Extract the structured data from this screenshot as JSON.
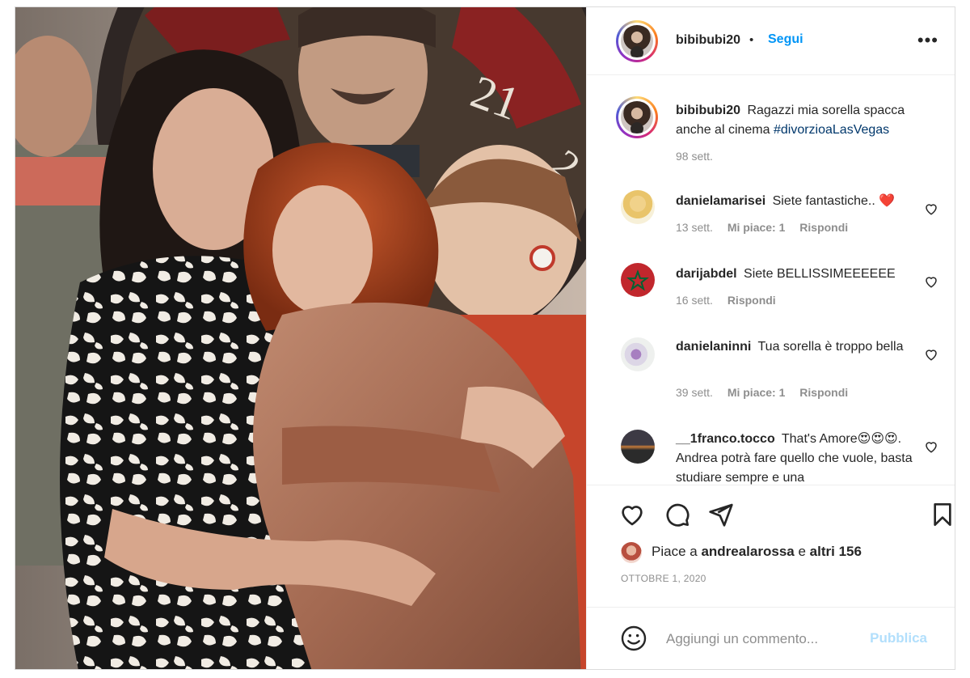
{
  "header": {
    "username": "bibibubi20",
    "dot": "•",
    "follow_label": "Segui",
    "more_label": "•••"
  },
  "caption": {
    "username": "bibibubi20",
    "text": "Ragazzi mia sorella spacca anche al cinema",
    "hashtag": "#divorzioaLasVegas",
    "time": "98 sett."
  },
  "comments": [
    {
      "username": "danielamarisei",
      "text": "Siete fantastiche..",
      "emoji": "❤️",
      "time": "13 sett.",
      "likes": "Mi piace: 1",
      "reply": "Rispondi"
    },
    {
      "username": "darijabdel",
      "text": "Siete BELLISSIMEEEEEE",
      "time": "16 sett.",
      "reply": "Rispondi"
    },
    {
      "username": "danielaninni",
      "text": "Tua sorella è troppo bella",
      "time": "39 sett.",
      "likes": "Mi piace: 1",
      "reply": "Rispondi"
    },
    {
      "username": "__1franco.tocco",
      "text": "That's Amore😍😍😍. Andrea potrà fare quello che vuole, basta studiare sempre e una"
    }
  ],
  "likes": {
    "prefix": "Piace a",
    "user": "andrealarossa",
    "conj": "e",
    "others": "altri 156"
  },
  "date": "OTTOBRE 1, 2020",
  "add_comment": {
    "placeholder": "Aggiungi un commento...",
    "publish_label": "Pubblica"
  },
  "colors": {
    "accent": "#0095f6",
    "publish_disabled": "#b2dffc",
    "hashtag": "#00376b",
    "muted": "#8e8e8e"
  },
  "icons": [
    "more-options-icon",
    "heart-icon",
    "comment-icon",
    "share-icon",
    "bookmark-icon",
    "emoji-icon"
  ]
}
